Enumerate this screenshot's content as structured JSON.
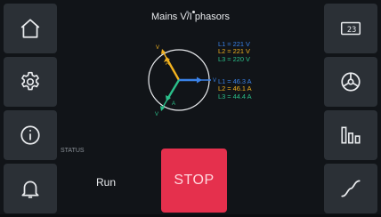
{
  "header": {
    "title": "Mains V/I phasors",
    "page_dots": 2,
    "active_dot": 1
  },
  "sidebar_left": [
    {
      "icon": "home-icon"
    },
    {
      "icon": "gear-icon"
    },
    {
      "icon": "info-icon"
    },
    {
      "icon": "bell-icon"
    }
  ],
  "sidebar_right": [
    {
      "icon": "display-value-icon",
      "text": "23"
    },
    {
      "icon": "steering-wheel-icon"
    },
    {
      "icon": "bar-chart-icon"
    },
    {
      "icon": "sine-wave-icon"
    }
  ],
  "phasor": {
    "voltage_label": "V",
    "current_label": "A",
    "colors": {
      "L1": "#3a82e8",
      "L2": "#f2b21f",
      "L3": "#2bc08a"
    }
  },
  "voltages": [
    {
      "text": "L1 = 221 V"
    },
    {
      "text": "L2 = 221 V"
    },
    {
      "text": "L3 = 220 V"
    }
  ],
  "currents": [
    {
      "text": "L1 = 46.3 A"
    },
    {
      "text": "L2 = 46.1 A"
    },
    {
      "text": "L3 = 44.4 A"
    }
  ],
  "status": {
    "label": "STATUS",
    "value": "Run"
  },
  "stop_button": {
    "label": "STOP",
    "color": "#e5304d"
  }
}
